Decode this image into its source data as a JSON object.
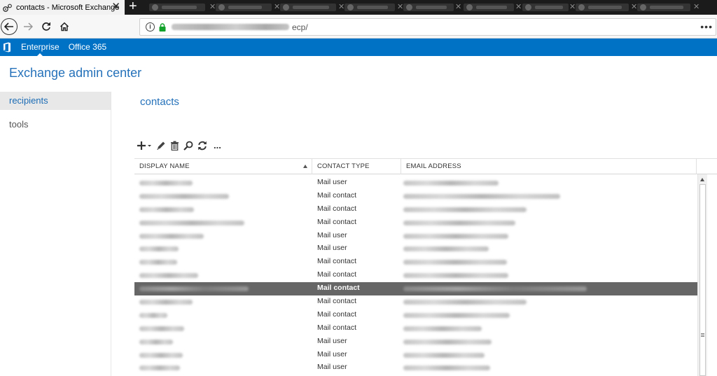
{
  "browser": {
    "active_tab_title": "contacts - Microsoft Exchange",
    "url_suffix": "ecp/"
  },
  "suite_bar": {
    "tabs": [
      {
        "label": "Enterprise",
        "active": true
      },
      {
        "label": "Office 365",
        "active": false
      }
    ]
  },
  "app_title": "Exchange admin center",
  "left_nav": {
    "items": [
      {
        "label": "recipients",
        "selected": true
      },
      {
        "label": "tools",
        "selected": false
      }
    ]
  },
  "page_title": "contacts",
  "toolbar": {
    "icons": [
      "add-icon",
      "edit-icon",
      "delete-icon",
      "search-icon",
      "refresh-icon",
      "more-icon"
    ],
    "more_label": "..."
  },
  "grid": {
    "columns": [
      "DISPLAY NAME",
      "CONTACT TYPE",
      "EMAIL ADDRESS"
    ],
    "sort_column": "DISPLAY NAME",
    "selected_row": 8,
    "rows": [
      {
        "contact_type": "Mail user"
      },
      {
        "contact_type": "Mail contact"
      },
      {
        "contact_type": "Mail contact"
      },
      {
        "contact_type": "Mail contact"
      },
      {
        "contact_type": "Mail user"
      },
      {
        "contact_type": "Mail user"
      },
      {
        "contact_type": "Mail contact"
      },
      {
        "contact_type": "Mail contact"
      },
      {
        "contact_type": "Mail contact"
      },
      {
        "contact_type": "Mail contact"
      },
      {
        "contact_type": "Mail contact"
      },
      {
        "contact_type": "Mail contact"
      },
      {
        "contact_type": "Mail user"
      },
      {
        "contact_type": "Mail user"
      },
      {
        "contact_type": "Mail user"
      }
    ]
  },
  "colors": {
    "suite_bar": "#0072c6",
    "accent_text": "#2672ba",
    "selected_row": "#666666"
  }
}
